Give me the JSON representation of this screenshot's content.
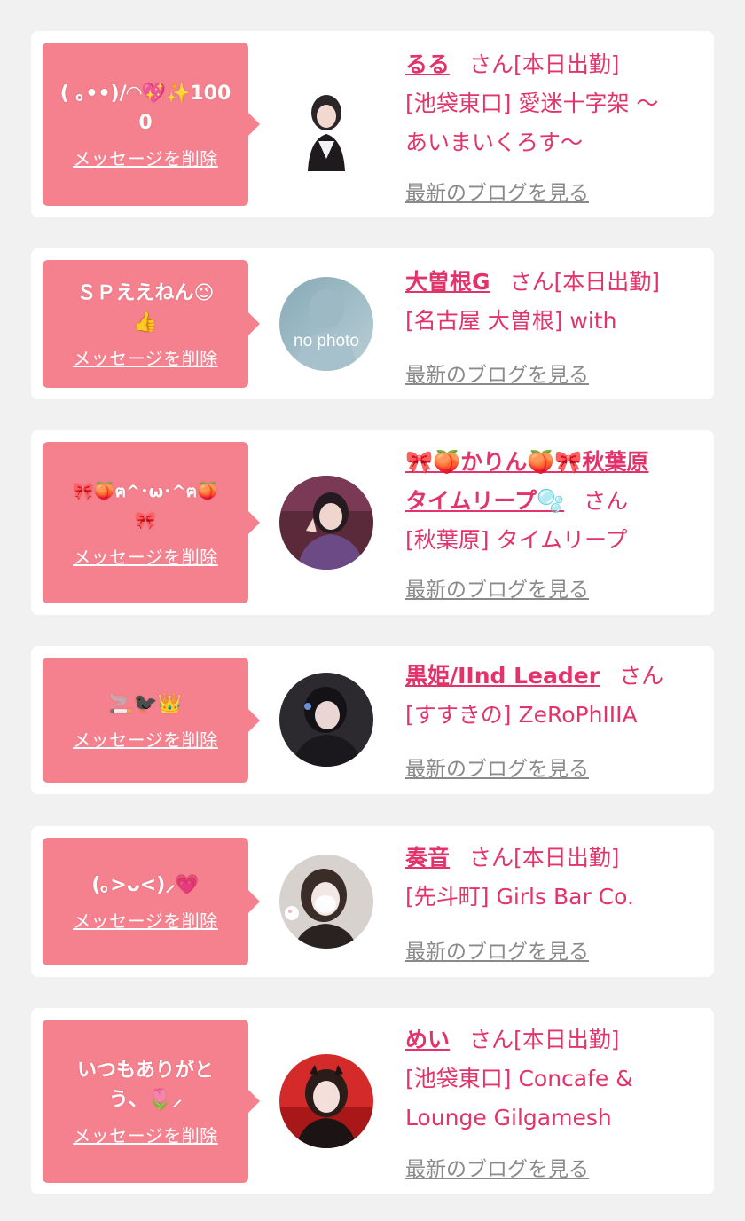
{
  "bg": "#f1f1f1",
  "accent": "#e2336a",
  "bubble_color": "#f6818e",
  "san_label": "さん",
  "delete_label": "メッセージを削除",
  "blog_label": "最新のブログを見る",
  "cards": [
    {
      "message_lines": [
        "( ｡••)/◠💖✨1000"
      ],
      "avatar": "cast-photo",
      "name": "るる",
      "status": "[本日出勤]",
      "shop_lines": [
        "[池袋東口] 愛迷十字架 〜",
        "あいまいくろす〜"
      ]
    },
    {
      "message_lines": [
        "ＳＰええねん😉",
        "👍"
      ],
      "avatar": "no-photo",
      "avatar_text": "no photo",
      "name": "大曽根G",
      "status": "[本日出勤]",
      "shop_lines": [
        "[名古屋 大曽根] with"
      ]
    },
    {
      "message_lines": [
        "🎀🍑ฅ^･ω･^ฅ🍑",
        "🎀"
      ],
      "avatar": "cast-photo",
      "name_lines": [
        "🎀🍑かりん🍑🎀秋葉原",
        "タイムリープ🫧"
      ],
      "status": "",
      "shop_lines": [
        "[秋葉原] タイムリープ"
      ]
    },
    {
      "message_lines": [
        "🚬🐦‍⬛👑"
      ],
      "avatar": "cast-photo",
      "name": "黒姫/IInd Leader",
      "status": "",
      "shop_lines": [
        "[すすきの] ZeRoPhIIIA"
      ]
    },
    {
      "message_lines": [
        "(｡>ᴗ<)⸝💗"
      ],
      "avatar": "cast-photo",
      "name": "奏音",
      "status": "[本日出勤]",
      "shop_lines": [
        "[先斗町] Girls Bar Co."
      ]
    },
    {
      "message_lines": [
        "いつもありがと",
        "う、🌷⸝"
      ],
      "avatar": "cast-photo",
      "name": "めい",
      "status": "[本日出勤]",
      "shop_lines": [
        "[池袋東口] Concafe &",
        "Lounge Gilgamesh"
      ]
    }
  ]
}
